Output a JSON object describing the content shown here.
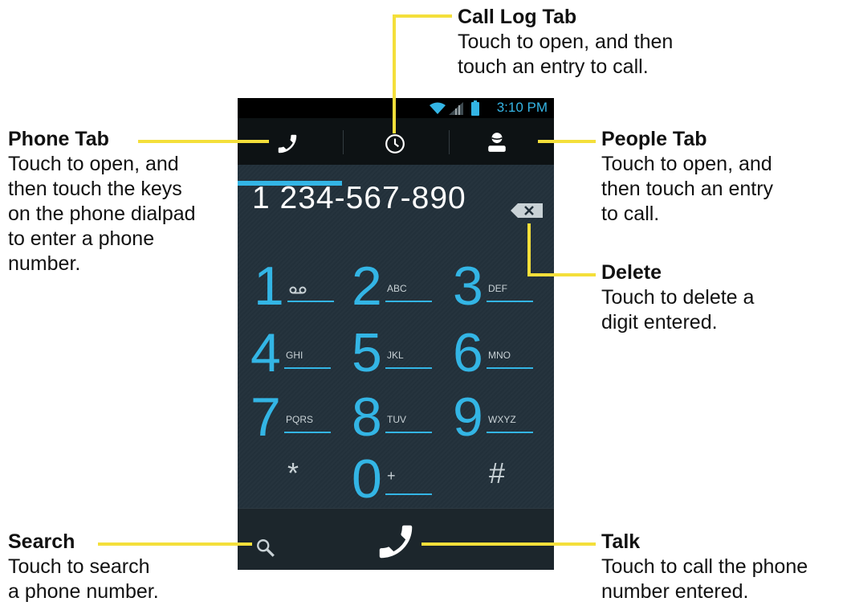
{
  "callouts": {
    "call_log": {
      "title": "Call Log Tab",
      "line1": "Touch to open, and then",
      "line2": "touch an entry to call."
    },
    "phone_tab": {
      "title": "Phone Tab",
      "line1": "Touch to open, and",
      "line2": "then touch the keys",
      "line3": "on the phone dialpad",
      "line4": "to enter a phone",
      "line5": "number."
    },
    "people_tab": {
      "title": "People Tab",
      "line1": "Touch to open, and",
      "line2": "then touch an entry",
      "line3": "to call."
    },
    "delete": {
      "title": "Delete",
      "line1": "Touch to delete a",
      "line2": "digit entered."
    },
    "search": {
      "title": "Search",
      "line1": "Touch to search",
      "line2": "a phone number."
    },
    "talk": {
      "title": "Talk",
      "line1": "Touch to call the phone",
      "line2": "number entered."
    }
  },
  "status": {
    "time": "3:10 PM"
  },
  "dialer": {
    "number": "1 234-567-890"
  },
  "keys": [
    {
      "digit": "1",
      "letters": ""
    },
    {
      "digit": "2",
      "letters": "ABC"
    },
    {
      "digit": "3",
      "letters": "DEF"
    },
    {
      "digit": "4",
      "letters": "GHI"
    },
    {
      "digit": "5",
      "letters": "JKL"
    },
    {
      "digit": "6",
      "letters": "MNO"
    },
    {
      "digit": "7",
      "letters": "PQRS"
    },
    {
      "digit": "8",
      "letters": "TUV"
    },
    {
      "digit": "9",
      "letters": "WXYZ"
    },
    {
      "digit": "0",
      "letters": "+"
    }
  ],
  "symbols": {
    "star": "*",
    "hash": "#"
  },
  "icons": {
    "phone_tab": "phone-icon",
    "call_log_tab": "clock-icon",
    "people_tab": "person-icon",
    "delete": "backspace-icon",
    "search": "search-icon",
    "talk": "phone-icon",
    "voicemail": "voicemail-icon"
  },
  "colors": {
    "accent": "#33b5e5",
    "callout_line": "#f4df3a"
  }
}
